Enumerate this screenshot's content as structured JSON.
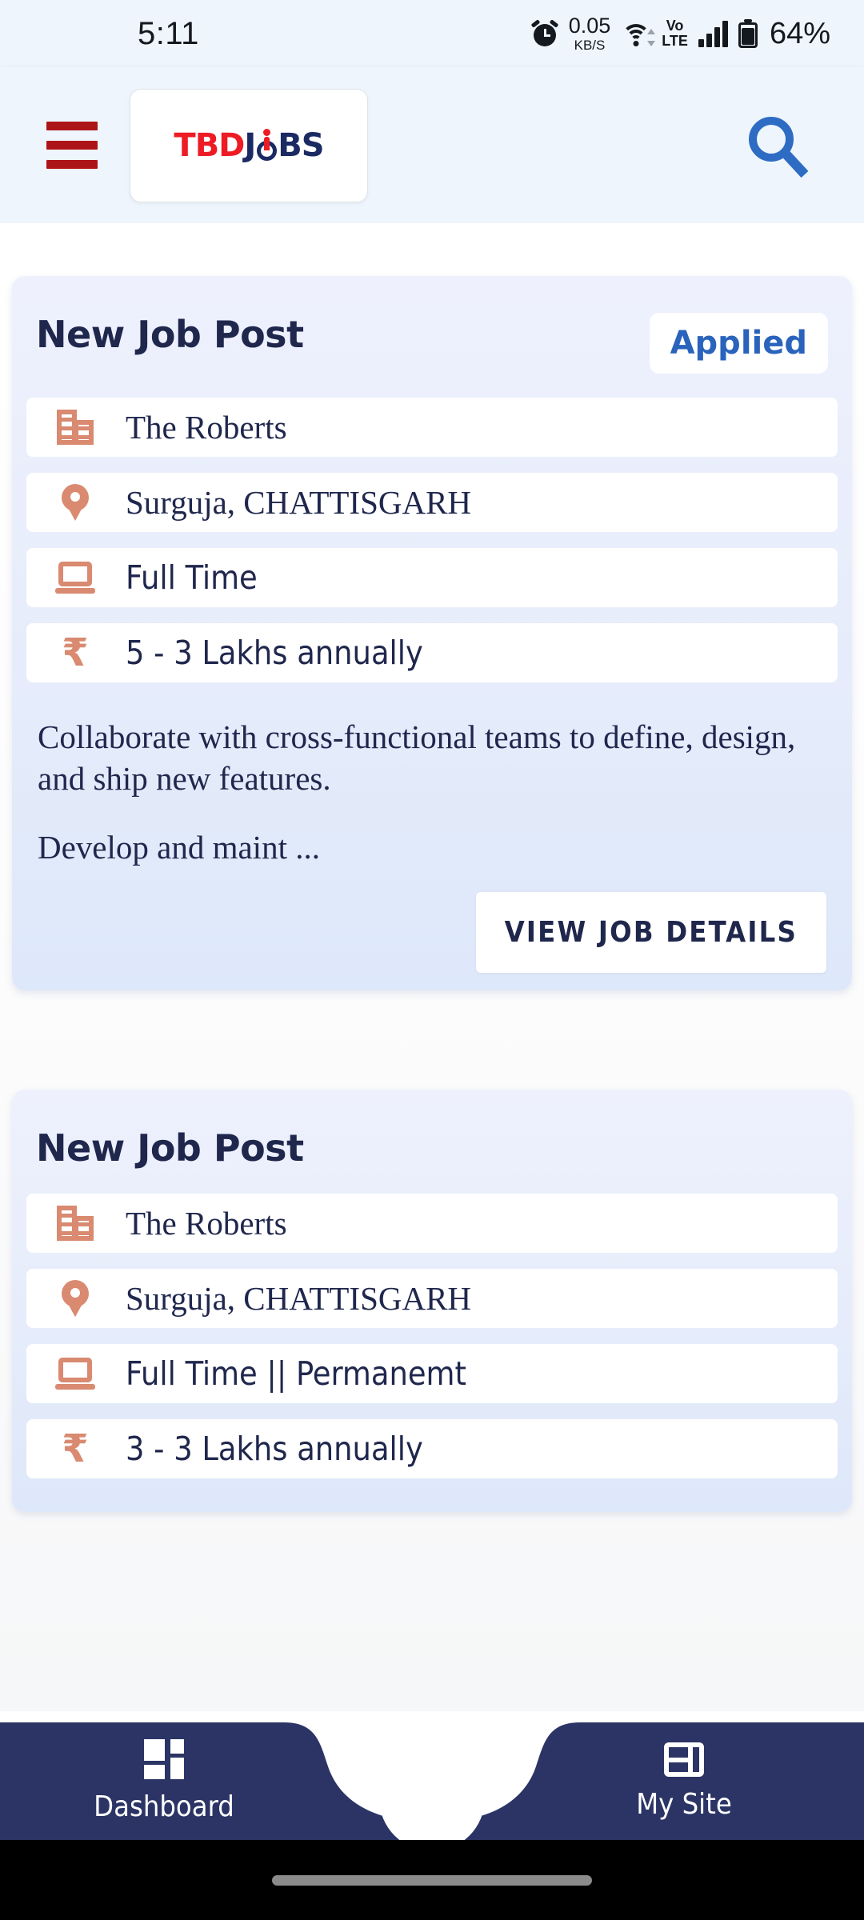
{
  "status_bar": {
    "time": "5:11",
    "network_speed_value": "0.05",
    "network_speed_unit": "KB/S",
    "volte_top": "Vo",
    "volte_bottom": "LTE",
    "battery_percent": "64%"
  },
  "header": {
    "menu_icon": "hamburger-menu-icon",
    "logo_part1": "TBD",
    "logo_part2": "J",
    "logo_part3": "BS",
    "logo_alt": "TBDJOBS",
    "search_icon": "search-icon",
    "colors": {
      "menu_red": "#ad1417",
      "logo_red": "#ed1c24",
      "logo_navy": "#1b2a63",
      "search_blue": "#2e6cc4",
      "bar_bg": "#eff5fc"
    }
  },
  "jobs": [
    {
      "title": "New Job Post",
      "badge": "Applied",
      "has_badge": true,
      "company": "The Roberts",
      "location": "Surguja, CHATTISGARH",
      "job_type": "Full Time",
      "salary": "5 - 3 Lakhs annually",
      "description_line1": "Collaborate with cross-functional teams to define, design, and ship new features.",
      "description_line2": "Develop and maint ...",
      "cta": "VIEW JOB DETAILS",
      "has_description": true
    },
    {
      "title": "New Job Post",
      "badge": "",
      "has_badge": false,
      "company": "The Roberts",
      "location": "Surguja, CHATTISGARH",
      "job_type": "Full Time || Permanemt",
      "salary": "3 - 3 Lakhs annually",
      "description_line1": "",
      "description_line2": "",
      "cta": "",
      "has_description": false
    }
  ],
  "row_icons": {
    "company": "building-icon",
    "location": "location-pin-icon",
    "job_type": "laptop-icon",
    "salary": "rupee-icon",
    "salary_glyph": "₹"
  },
  "bottom_nav": {
    "left_label": "Dashboard",
    "left_icon": "dashboard-grid-icon",
    "right_label": "My Site",
    "right_icon": "site-layout-icon",
    "fab_icon": "floating-action-button",
    "bg_color": "#2b3465"
  },
  "theme": {
    "card_bg_top": "#eef1fd",
    "card_bg_bottom": "#dde8fa",
    "text_navy": "#20274d",
    "accent_salmon": "#d98a70",
    "accent_blue": "#2a63bc"
  }
}
